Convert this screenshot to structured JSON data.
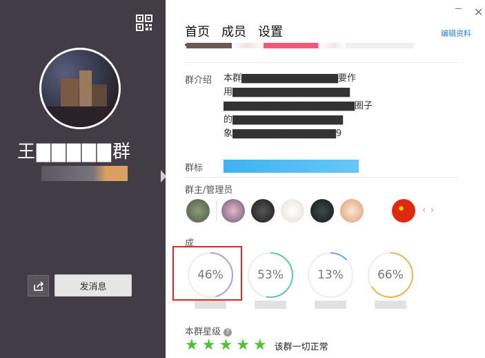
{
  "left": {
    "group_name": "王▇▇▇▇▇群",
    "send_button": "发消息",
    "icons": {
      "qr": "qr-code-icon",
      "share": "share-icon"
    }
  },
  "tabs": [
    {
      "label": "首页",
      "active": true
    },
    {
      "label": "成员",
      "active": false
    },
    {
      "label": "设置",
      "active": false
    }
  ],
  "edit_link": "编辑资料",
  "intro": {
    "label": "群介绍",
    "lines": [
      "本群▇▇▇▇▇▇▇▇▇▇▇▇▇▇要作",
      "用▇▇▇▇▇▇▇▇▇▇▇▇▇▇▇▇▇",
      "▇▇▇▇▇▇▇▇▇▇▇▇▇▇▇▇▇▇▇圈子",
      "的▇▇▇▇▇▇▇▇▇▇▇▇▇▇▇▇",
      "象▇▇▇▇▇▇▇▇▇▇▇▇▇▇▇9"
    ]
  },
  "tags_label": "群标",
  "admins_label": "群主/管理员",
  "members_label": "成",
  "stats": [
    {
      "percent": "46%",
      "value": 46,
      "color": "#b39be6",
      "highlighted": true
    },
    {
      "percent": "53%",
      "value": 53,
      "color": "#58c9a0",
      "highlighted": false
    },
    {
      "percent": "13%",
      "value": 13,
      "color": "#6aa6ee",
      "highlighted": false
    },
    {
      "percent": "66%",
      "value": 66,
      "color": "#f0b44a",
      "highlighted": false
    }
  ],
  "rating": {
    "label": "本群星级",
    "stars": 5,
    "status": "该群一切正常"
  },
  "colors": {
    "accent": "#2a7fd4",
    "star": "#4cc331",
    "highlight": "#e0261e",
    "left_bg": "#423c46"
  }
}
